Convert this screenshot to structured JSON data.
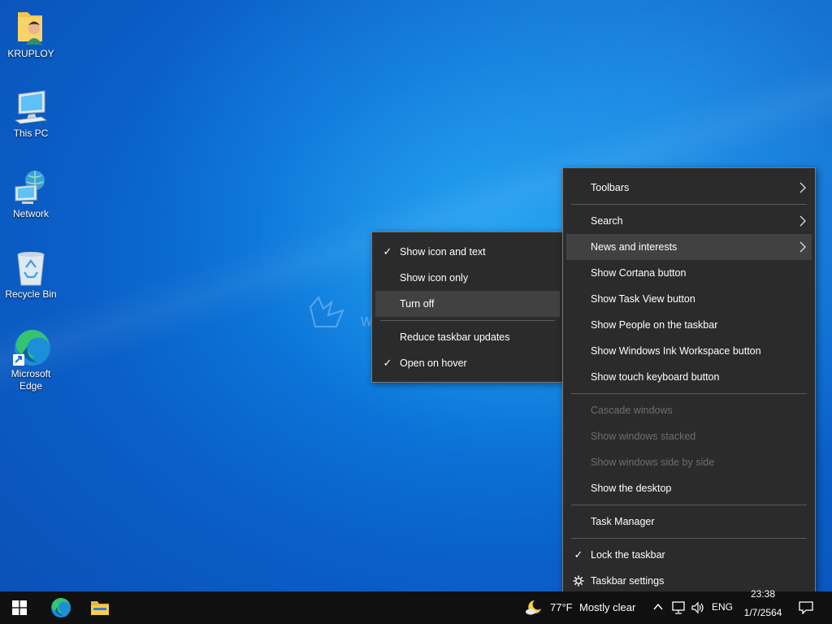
{
  "desktop": {
    "icons": [
      {
        "label": "KRUPLOY",
        "icon": "user-folder-icon"
      },
      {
        "label": "This PC",
        "icon": "computer-icon"
      },
      {
        "label": "Network",
        "icon": "network-icon"
      },
      {
        "label": "Recycle Bin",
        "icon": "recycle-bin-icon"
      },
      {
        "label": "Microsoft Edge",
        "icon": "edge-icon"
      }
    ],
    "watermark": "www.KRUPLOY.com"
  },
  "taskbar_menu": {
    "items": [
      {
        "label": "Toolbars",
        "submenu": true
      },
      {
        "label": "Search",
        "submenu": true
      },
      {
        "label": "News and interests",
        "submenu": true,
        "highlighted": true
      },
      {
        "label": "Show Cortana button"
      },
      {
        "label": "Show Task View button"
      },
      {
        "label": "Show People on the taskbar"
      },
      {
        "label": "Show Windows Ink Workspace button"
      },
      {
        "label": "Show touch keyboard button"
      },
      {
        "label": "Cascade windows",
        "disabled": true
      },
      {
        "label": "Show windows stacked",
        "disabled": true
      },
      {
        "label": "Show windows side by side",
        "disabled": true
      },
      {
        "label": "Show the desktop"
      },
      {
        "label": "Task Manager"
      },
      {
        "label": "Lock the taskbar",
        "checked": true
      },
      {
        "label": "Taskbar settings",
        "icon": "gear-icon"
      }
    ],
    "check_glyph": "✓"
  },
  "news_submenu": {
    "items": [
      {
        "label": "Show icon and text",
        "checked": true
      },
      {
        "label": "Show icon only"
      },
      {
        "label": "Turn off",
        "highlighted": true
      },
      {
        "label": "Reduce taskbar updates"
      },
      {
        "label": "Open on hover",
        "checked": true
      }
    ]
  },
  "taskbar": {
    "pinned": [
      {
        "name": "start",
        "icon": "windows-logo-icon"
      },
      {
        "name": "edge",
        "icon": "edge-icon"
      },
      {
        "name": "file-explorer",
        "icon": "folder-icon"
      }
    ],
    "weather": {
      "temp": "77°F",
      "condition": "Mostly clear",
      "icon": "moon-cloud-icon"
    },
    "tray": {
      "language": "ENG",
      "time": "23:38",
      "date": "1/7/2564"
    }
  },
  "colors": {
    "menu_bg": "#2b2b2b",
    "menu_highlight": "#414141",
    "taskbar_bg": "#101010",
    "desktop_accent": "#0b74d8"
  }
}
